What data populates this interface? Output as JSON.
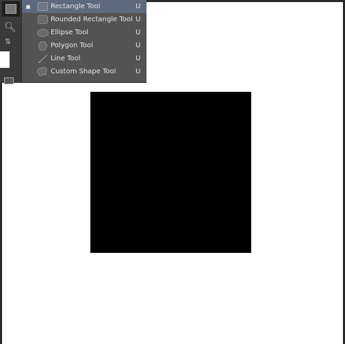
{
  "menu": {
    "items": [
      {
        "label": "Rectangle Tool",
        "shortcut": "U",
        "icon": "rectangle-icon",
        "selected": true
      },
      {
        "label": "Rounded Rectangle Tool",
        "shortcut": "U",
        "icon": "rounded-rectangle-icon"
      },
      {
        "label": "Ellipse Tool",
        "shortcut": "U",
        "icon": "ellipse-icon"
      },
      {
        "label": "Polygon Tool",
        "shortcut": "U",
        "icon": "polygon-icon"
      },
      {
        "label": "Line Tool",
        "shortcut": "U",
        "icon": "line-icon"
      },
      {
        "label": "Custom Shape Tool",
        "shortcut": "U",
        "icon": "custom-shape-icon"
      }
    ]
  },
  "colors": {
    "selection": "#5d6a7d",
    "menu_bg": "#535353",
    "shape_fill": "#000000"
  }
}
